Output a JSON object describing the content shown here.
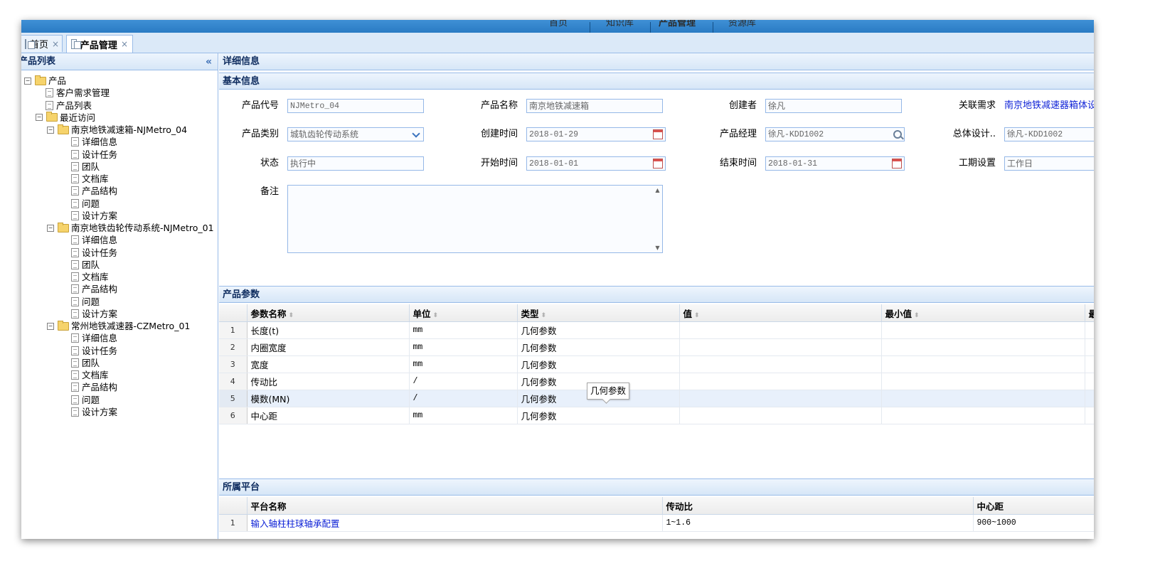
{
  "nav": {
    "items": [
      "首页",
      "知识库",
      "产品管理",
      "资源库"
    ]
  },
  "tabs": [
    {
      "label": "首页",
      "close": "×",
      "active": false
    },
    {
      "label": "产品管理",
      "close": "×",
      "active": true
    }
  ],
  "left_panel": {
    "title": "产品列表",
    "collapse_glyph": "«",
    "tree": [
      {
        "label": "产品",
        "type": "folder",
        "level": 0,
        "toggle": "−"
      },
      {
        "label": "客户需求管理",
        "type": "page",
        "level": 1
      },
      {
        "label": "产品列表",
        "type": "page",
        "level": 1
      },
      {
        "label": "最近访问",
        "type": "folder",
        "level": 1,
        "toggle": "−"
      },
      {
        "label": "南京地铁减速箱-NJMetro_04",
        "type": "folder",
        "level": 2,
        "toggle": "−"
      },
      {
        "label": "详细信息",
        "type": "page",
        "level": 3
      },
      {
        "label": "设计任务",
        "type": "page",
        "level": 3
      },
      {
        "label": "团队",
        "type": "page",
        "level": 3
      },
      {
        "label": "文档库",
        "type": "page",
        "level": 3
      },
      {
        "label": "产品结构",
        "type": "page",
        "level": 3
      },
      {
        "label": "问题",
        "type": "page",
        "level": 3
      },
      {
        "label": "设计方案",
        "type": "page",
        "level": 3
      },
      {
        "label": "南京地铁齿轮传动系统-NJMetro_01",
        "type": "folder",
        "level": 2,
        "toggle": "−"
      },
      {
        "label": "详细信息",
        "type": "page",
        "level": 3
      },
      {
        "label": "设计任务",
        "type": "page",
        "level": 3
      },
      {
        "label": "团队",
        "type": "page",
        "level": 3
      },
      {
        "label": "文档库",
        "type": "page",
        "level": 3
      },
      {
        "label": "产品结构",
        "type": "page",
        "level": 3
      },
      {
        "label": "问题",
        "type": "page",
        "level": 3
      },
      {
        "label": "设计方案",
        "type": "page",
        "level": 3
      },
      {
        "label": "常州地铁减速器-CZMetro_01",
        "type": "folder",
        "level": 2,
        "toggle": "−"
      },
      {
        "label": "详细信息",
        "type": "page",
        "level": 3
      },
      {
        "label": "设计任务",
        "type": "page",
        "level": 3
      },
      {
        "label": "团队",
        "type": "page",
        "level": 3
      },
      {
        "label": "文档库",
        "type": "page",
        "level": 3
      },
      {
        "label": "产品结构",
        "type": "page",
        "level": 3
      },
      {
        "label": "问题",
        "type": "page",
        "level": 3
      },
      {
        "label": "设计方案",
        "type": "page",
        "level": 3
      }
    ]
  },
  "detail": {
    "title": "详细信息",
    "basic_title": "基本信息",
    "fields": {
      "product_code": {
        "label": "产品代号",
        "value": "NJMetro_04"
      },
      "product_name": {
        "label": "产品名称",
        "value": "南京地铁减速箱"
      },
      "creator": {
        "label": "创建者",
        "value": "徐凡"
      },
      "related_req": {
        "label": "关联需求",
        "value": "南京地铁减速器箱体设计"
      },
      "category": {
        "label": "产品类别",
        "value": "城轨齿轮传动系统"
      },
      "created_time": {
        "label": "创建时间",
        "value": "2018-01-29"
      },
      "manager": {
        "label": "产品经理",
        "value": "徐凡-KDD1002"
      },
      "chief_designer": {
        "label": "总体设计..",
        "value": "徐凡-KDD1002"
      },
      "status": {
        "label": "状态",
        "value": "执行中"
      },
      "start_time": {
        "label": "开始时间",
        "value": "2018-01-01"
      },
      "end_time": {
        "label": "结束时间",
        "value": "2018-01-31"
      },
      "schedule": {
        "label": "工期设置",
        "value": "工作日"
      },
      "remark": {
        "label": "备注",
        "value": ""
      }
    }
  },
  "params": {
    "title": "产品参数",
    "sort_glyph": "⬍",
    "columns": [
      "参数名称",
      "单位",
      "类型",
      "值",
      "最小值",
      "最"
    ],
    "rows": [
      {
        "n": "1",
        "name": "长度(t)",
        "unit": "mm",
        "type": "几何参数",
        "value": "",
        "min": ""
      },
      {
        "n": "2",
        "name": "内圈宽度",
        "unit": "mm",
        "type": "几何参数",
        "value": "",
        "min": ""
      },
      {
        "n": "3",
        "name": "宽度",
        "unit": "mm",
        "type": "几何参数",
        "value": "",
        "min": ""
      },
      {
        "n": "4",
        "name": "传动比",
        "unit": "/",
        "type": "几何参数",
        "value": "",
        "min": ""
      },
      {
        "n": "5",
        "name": "模数(MN)",
        "unit": "/",
        "type": "几何参数",
        "value": "",
        "min": ""
      },
      {
        "n": "6",
        "name": "中心距",
        "unit": "mm",
        "type": "几何参数",
        "value": "",
        "min": ""
      }
    ],
    "tooltip": "几何参数"
  },
  "platform": {
    "title": "所属平台",
    "columns": [
      "平台名称",
      "传动比",
      "中心距"
    ],
    "rows": [
      {
        "n": "1",
        "name": "输入轴柱柱球轴承配置",
        "ratio": "1~1.6",
        "distance": "900~1000"
      }
    ]
  }
}
